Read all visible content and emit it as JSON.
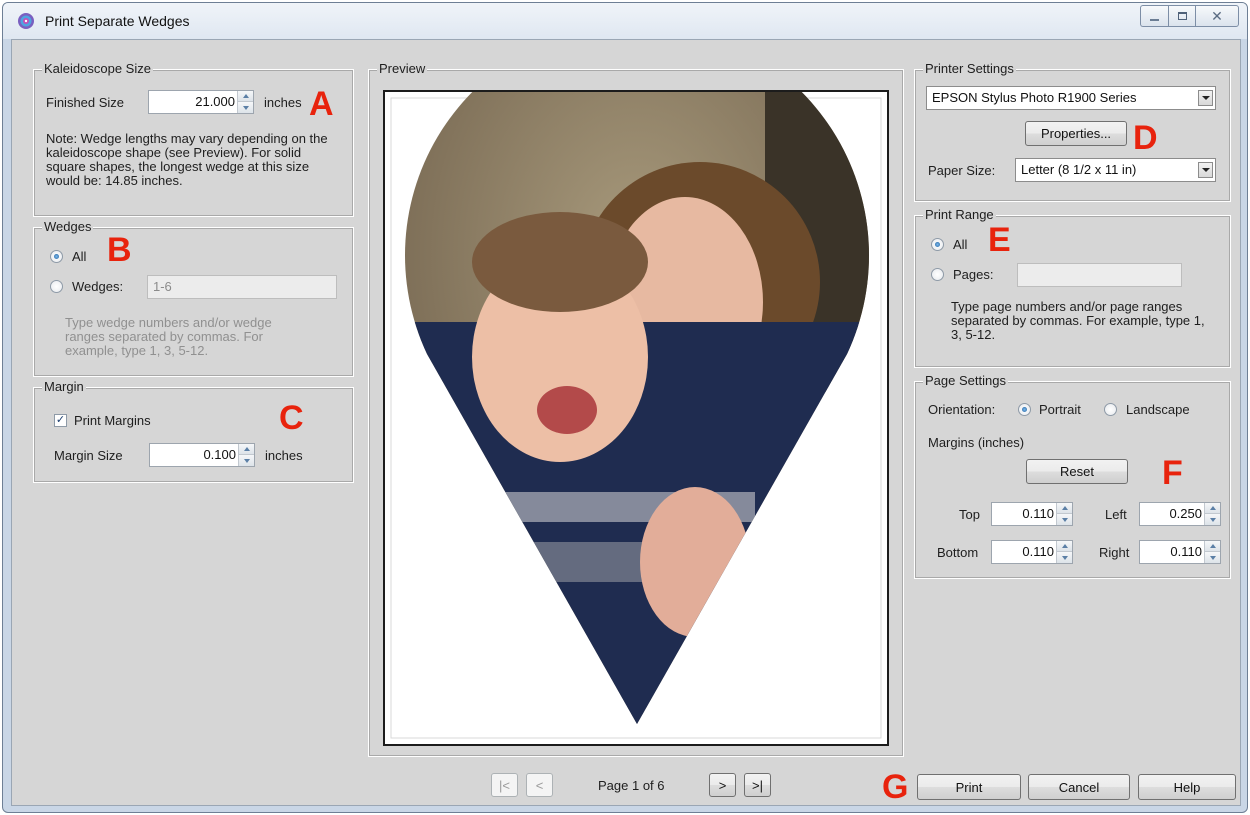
{
  "window": {
    "title": "Print Separate Wedges"
  },
  "kaleidoscope_size": {
    "group_title": "Kaleidoscope Size",
    "finished_size_label": "Finished Size",
    "finished_size_value": "21.000",
    "unit": "inches",
    "note": "Note: Wedge lengths may vary depending on the kaleidoscope shape (see Preview). For solid square shapes, the longest wedge at this size would be: 14.85 inches."
  },
  "wedges": {
    "group_title": "Wedges",
    "all_label": "All",
    "wedges_label": "Wedges:",
    "wedges_value": "1-6",
    "help": "Type wedge numbers and/or wedge ranges separated by commas. For example, type 1, 3, 5-12."
  },
  "margin": {
    "group_title": "Margin",
    "print_margins_label": "Print Margins",
    "print_margins_checked": true,
    "margin_size_label": "Margin Size",
    "margin_size_value": "0.100",
    "unit": "inches"
  },
  "preview": {
    "group_title": "Preview",
    "page_text": "Page 1 of 6",
    "first_label": "|<",
    "prev_label": "<",
    "next_label": ">",
    "last_label": ">|"
  },
  "printer_settings": {
    "group_title": "Printer Settings",
    "printer_value": "EPSON Stylus Photo R1900 Series",
    "properties_label": "Properties...",
    "paper_size_label": "Paper Size:",
    "paper_size_value": "Letter (8 1/2 x 11 in)"
  },
  "print_range": {
    "group_title": "Print Range",
    "all_label": "All",
    "pages_label": "Pages:",
    "pages_value": "",
    "help": "Type page numbers and/or page ranges separated by commas.  For example, type 1, 3, 5-12."
  },
  "page_settings": {
    "group_title": "Page Settings",
    "orientation_label": "Orientation:",
    "portrait_label": "Portrait",
    "landscape_label": "Landscape",
    "margins_label": "Margins (inches)",
    "reset_label": "Reset",
    "top_label": "Top",
    "top_value": "0.110",
    "left_label": "Left",
    "left_value": "0.250",
    "bottom_label": "Bottom",
    "bottom_value": "0.110",
    "right_label": "Right",
    "right_value": "0.110"
  },
  "footer": {
    "print_label": "Print",
    "cancel_label": "Cancel",
    "help_label": "Help"
  },
  "markers": {
    "a": "A",
    "b": "B",
    "c": "C",
    "d": "D",
    "e": "E",
    "f": "F",
    "g": "G"
  },
  "colors": {
    "marker": "#e8230d",
    "dialog_bg": "#d6d6d6",
    "title_bar": "#dfe7f1"
  }
}
